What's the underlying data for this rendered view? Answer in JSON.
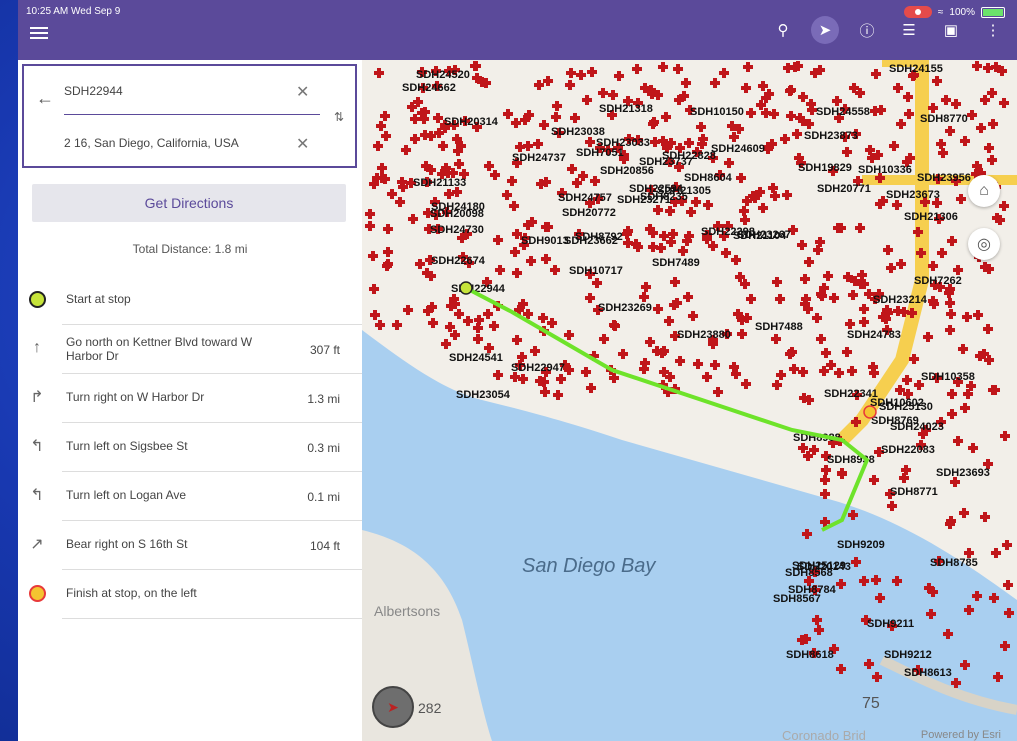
{
  "status": {
    "time_date": "10:25 AM  Wed Sep 9",
    "battery": "100%"
  },
  "toolbar": {
    "icons": [
      "search-icon",
      "directions-icon",
      "info-icon",
      "layers-icon",
      "camera-icon",
      "more-icon"
    ]
  },
  "route": {
    "from_value": "SDH22944",
    "to_value": "2 16, San Diego, California, USA"
  },
  "get_directions_label": "Get Directions",
  "total_distance": "Total Distance: 1.8 mi",
  "steps": [
    {
      "text": "Start at stop",
      "dist": "",
      "icon": "start-stop-icon"
    },
    {
      "text": "Go north on Kettner Blvd toward W Harbor Dr",
      "dist": "307 ft",
      "icon": "straight-arrow-icon"
    },
    {
      "text": "Turn right on W Harbor Dr",
      "dist": "1.3 mi",
      "icon": "turn-right-icon"
    },
    {
      "text": "Turn left on Sigsbee St",
      "dist": "0.3 mi",
      "icon": "turn-left-icon"
    },
    {
      "text": "Turn left on Logan Ave",
      "dist": "0.1 mi",
      "icon": "turn-left-icon"
    },
    {
      "text": "Bear right on S 16th St",
      "dist": "104 ft",
      "icon": "bear-right-icon"
    },
    {
      "text": "Finish at stop, on the left",
      "dist": "",
      "icon": "finish-stop-icon"
    }
  ],
  "map": {
    "bay_label": "San Diego Bay",
    "place_labels": [
      "Albertsons",
      "Coronado Brid"
    ],
    "compass_value": "282",
    "scale_value": "75",
    "attribution": "Powered by Esri",
    "colors": {
      "water": "#a9cff0",
      "land": "#f2efe9",
      "route": "#6ee32a",
      "marker": "#c0161a",
      "highway": "#f6cf4f"
    },
    "point_labels": [
      "SDH24783",
      "SDH24520",
      "SDH23956",
      "SDH23673",
      "SDH24155",
      "SDH20856",
      "SDH21104",
      "SDH10336",
      "SDH24662",
      "SDH8792",
      "SDH24737",
      "SDH22947",
      "SDH23269",
      "SDH23033",
      "SDH23038",
      "SDH24730",
      "SDH23267",
      "SDH24609",
      "SDH24558",
      "SDH20772",
      "SDH23271",
      "SDH22341",
      "SDH20771",
      "SDH23054",
      "SDH8235",
      "SDH10717",
      "SDH21133",
      "SDH22944",
      "SDH23662",
      "SDH23880",
      "SDH20314",
      "SDH24180",
      "SDH23214",
      "SDH23873",
      "SDH7262",
      "SDH22594",
      "SDH21318",
      "SDH9013",
      "SDH10150",
      "SDH7051",
      "SDH24757",
      "SDH8604",
      "SDH10358",
      "SDH7489",
      "SDH19829",
      "SDH22298",
      "SDH20098",
      "SDH21305",
      "SDH22828",
      "SDH23737",
      "SDH24541",
      "SDH22674",
      "SDH21306",
      "SDH8770",
      "SDH7488",
      "SDH23693",
      "SDH9209",
      "SDH22083",
      "SDH8769",
      "SDH8771",
      "SDH8988",
      "SDH8938",
      "SDH8618",
      "SDH8613",
      "SDH10602",
      "SDH25129",
      "SDH25130",
      "SDH9211",
      "SDH8567",
      "SDH8568",
      "SDH9212",
      "SDH20143",
      "SDH24023",
      "SDH8784",
      "SDH8785"
    ]
  }
}
